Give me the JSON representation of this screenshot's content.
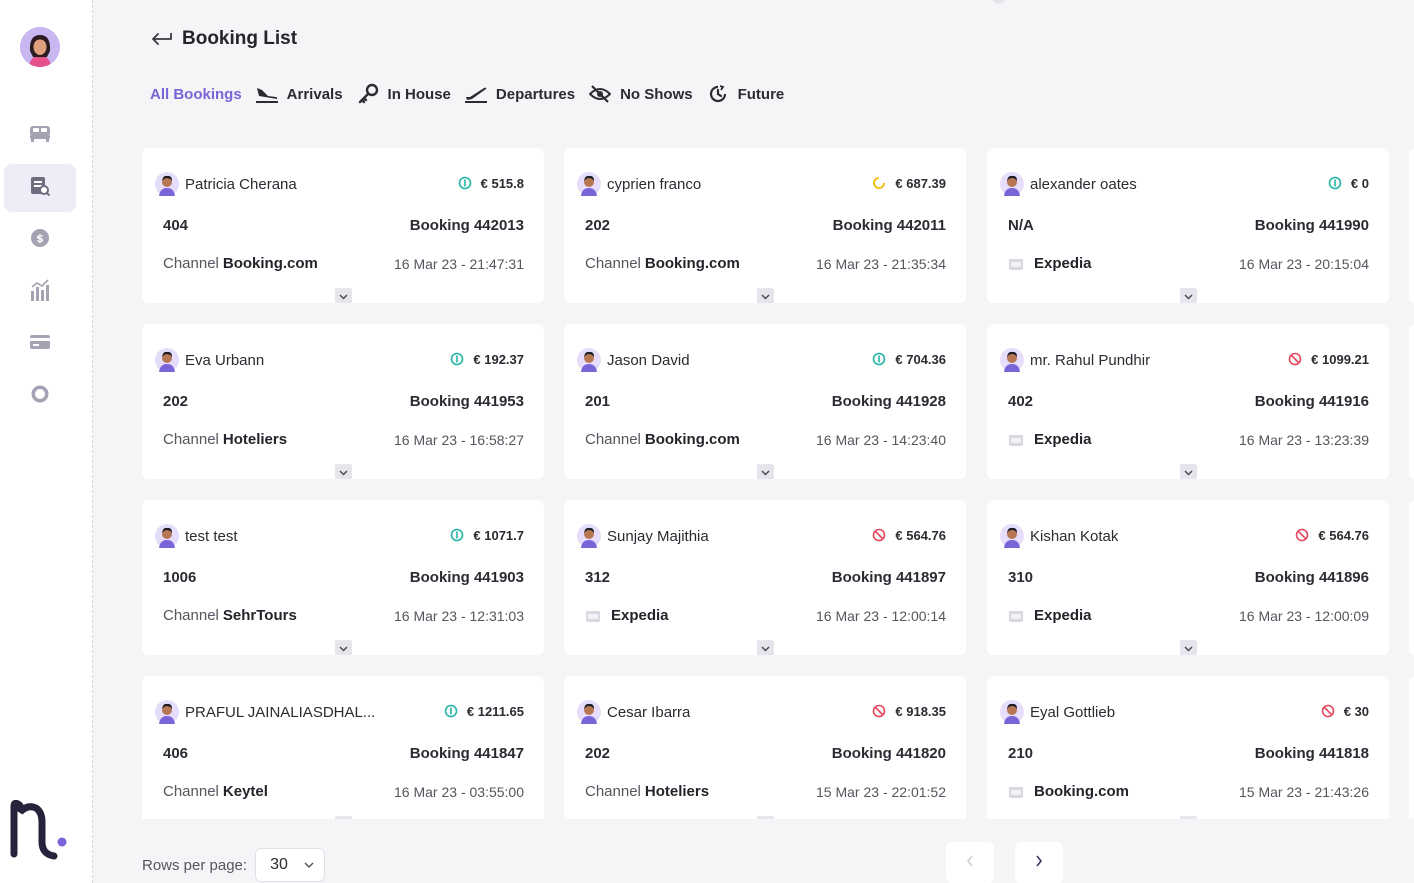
{
  "header": {
    "title": "Booking List"
  },
  "tabs": [
    {
      "label": "All Bookings",
      "icon": "list-icon",
      "active": true
    },
    {
      "label": "Arrivals",
      "icon": "plane-landing-icon"
    },
    {
      "label": "In House",
      "icon": "key-icon"
    },
    {
      "label": "Departures",
      "icon": "plane-takeoff-icon"
    },
    {
      "label": "No Shows",
      "icon": "eye-off-icon"
    },
    {
      "label": "Future",
      "icon": "clock-icon"
    }
  ],
  "sidebar": {
    "items": [
      {
        "name": "bed-icon"
      },
      {
        "name": "booking-list-icon",
        "active": true
      },
      {
        "name": "coin-icon"
      },
      {
        "name": "analytics-icon"
      },
      {
        "name": "card-icon"
      },
      {
        "name": "settings-icon"
      }
    ]
  },
  "cards": [
    {
      "guest": "Patricia Cherana",
      "status": "paid",
      "amount": "€ 515.8",
      "room": "404",
      "booking": "Booking 442013",
      "channel_prefix": "Channel",
      "channel": "Booking.com",
      "date": "16 Mar 23 - 21:47:31"
    },
    {
      "guest": "cyprien franco",
      "status": "pending",
      "amount": "€ 687.39",
      "room": "202",
      "booking": "Booking 442011",
      "channel_prefix": "Channel",
      "channel": "Booking.com",
      "date": "16 Mar 23 - 21:35:34"
    },
    {
      "guest": "alexander oates",
      "status": "paid",
      "amount": "€ 0",
      "room": "N/A",
      "booking": "Booking 441990",
      "channel_prefix": "",
      "channel": "Expedia",
      "date": "16 Mar 23 - 20:15:04"
    },
    {
      "guest": "Eva Urbann",
      "status": "paid",
      "amount": "€ 192.37",
      "room": "202",
      "booking": "Booking 441953",
      "channel_prefix": "Channel",
      "channel": "Hoteliers",
      "date": "16 Mar 23 - 16:58:27"
    },
    {
      "guest": "Jason David",
      "status": "paid",
      "amount": "€ 704.36",
      "room": "201",
      "booking": "Booking 441928",
      "channel_prefix": "Channel",
      "channel": "Booking.com",
      "date": "16 Mar 23 - 14:23:40"
    },
    {
      "guest": "mr. Rahul Pundhir",
      "status": "cancelled",
      "amount": "€ 1099.21",
      "room": "402",
      "booking": "Booking 441916",
      "channel_prefix": "",
      "channel": "Expedia",
      "date": "16 Mar 23 - 13:23:39"
    },
    {
      "guest": "test test",
      "status": "paid",
      "amount": "€ 1071.7",
      "room": "1006",
      "booking": "Booking 441903",
      "channel_prefix": "Channel",
      "channel": "SehrTours",
      "date": "16 Mar 23 - 12:31:03"
    },
    {
      "guest": "Sunjay Majithia",
      "status": "cancelled",
      "amount": "€ 564.76",
      "room": "312",
      "booking": "Booking 441897",
      "channel_prefix": "",
      "channel": "Expedia",
      "date": "16 Mar 23 - 12:00:14"
    },
    {
      "guest": "Kishan Kotak",
      "status": "cancelled",
      "amount": "€ 564.76",
      "room": "310",
      "booking": "Booking 441896",
      "channel_prefix": "",
      "channel": "Expedia",
      "date": "16 Mar 23 - 12:00:09"
    },
    {
      "guest": "PRAFUL JAINALIASDHAL...",
      "status": "paid",
      "amount": "€ 1211.65",
      "room": "406",
      "booking": "Booking 441847",
      "channel_prefix": "Channel",
      "channel": "Keytel",
      "date": "16 Mar 23 - 03:55:00"
    },
    {
      "guest": "Cesar Ibarra",
      "status": "cancelled",
      "amount": "€ 918.35",
      "room": "202",
      "booking": "Booking 441820",
      "channel_prefix": "Channel",
      "channel": "Hoteliers",
      "date": "15 Mar 23 - 22:01:52"
    },
    {
      "guest": "Eyal Gottlieb",
      "status": "cancelled",
      "amount": "€ 30",
      "room": "210",
      "booking": "Booking 441818",
      "channel_prefix": "",
      "channel": "Booking.com",
      "date": "15 Mar 23 - 21:43:26"
    }
  ],
  "pagination": {
    "rows_label": "Rows per page:",
    "rows_value": "30"
  },
  "colors": {
    "accent": "#7b63d8",
    "paid": "#22b5a8",
    "pending": "#f2c11b",
    "cancelled": "#e8485e"
  }
}
